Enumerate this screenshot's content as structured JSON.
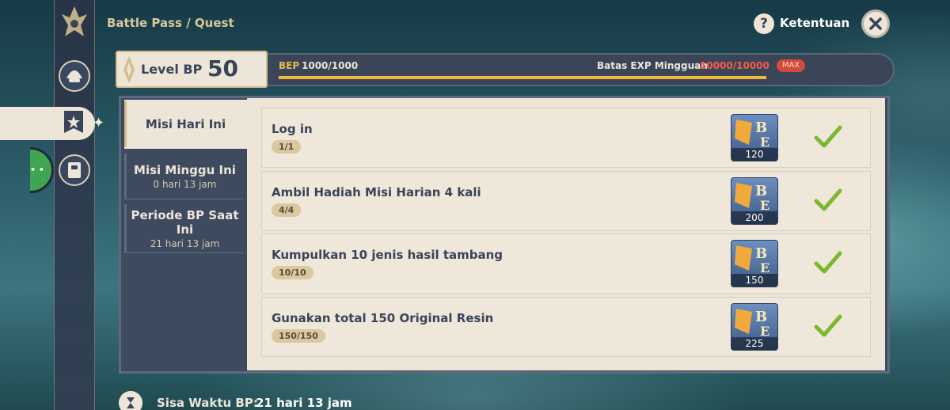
{
  "breadcrumb": "Battle Pass / Quest",
  "header": {
    "help_label": "Ketentuan",
    "help_glyph": "?"
  },
  "bp": {
    "level_label": "Level BP",
    "level_value": "50",
    "bep_label": "BEP",
    "bep_value": "1000/1000",
    "bep_progress": 1.0,
    "weekly_exp_label": "Batas EXP Mingguan",
    "weekly_exp_value": "10000/10000",
    "max_badge": "MAX"
  },
  "tabs": [
    {
      "title": "Misi Hari Ini",
      "subtitle": ""
    },
    {
      "title": "Misi Minggu Ini",
      "subtitle": "0 hari 13 jam"
    },
    {
      "title": "Periode BP Saat Ini",
      "subtitle": "21 hari 13 jam"
    }
  ],
  "quests": [
    {
      "title": "Log in",
      "progress": "1/1",
      "reward": "120",
      "completed": true
    },
    {
      "title": "Ambil Hadiah Misi Harian 4 kali",
      "progress": "4/4",
      "reward": "200",
      "completed": true
    },
    {
      "title": "Kumpulkan 10 jenis hasil tambang",
      "progress": "10/10",
      "reward": "150",
      "completed": true
    },
    {
      "title": "Gunakan total 150 Original Resin",
      "progress": "150/150",
      "reward": "225",
      "completed": true
    }
  ],
  "footer": {
    "label": "Sisa Waktu BP:",
    "value": "21 hari 13 jam"
  },
  "colors": {
    "panel_bg": "#ece5d8",
    "dark_bg": "#3e4a5e",
    "accent_gold": "#f2b93a",
    "exp_red": "#ff5a4a",
    "check_green": "#7cb82f"
  },
  "icons": {
    "rail_logo": "battle-pass-emblem-icon",
    "rail_items": [
      "shell-icon",
      "banner-quest-icon",
      "scroll-note-icon"
    ],
    "close": "close-icon",
    "help": "help-icon",
    "reward": "bp-exp-icon",
    "check": "check-icon",
    "footer": "timer-icon"
  }
}
